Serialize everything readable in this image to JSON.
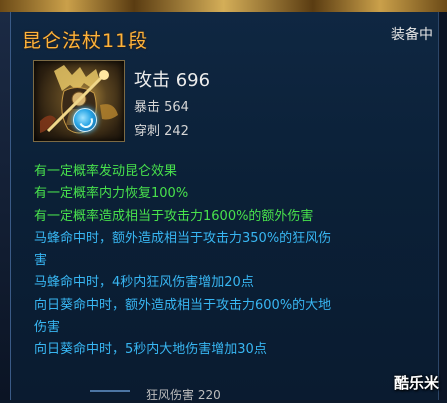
{
  "item": {
    "title": "昆仑法杖11段",
    "status": "装备中",
    "main_stat": "攻击 696",
    "sub_stats": [
      "暴击 564",
      "穿刺 242"
    ]
  },
  "effects": [
    {
      "text": "有一定概率发动昆仑效果",
      "color": "#48e14c"
    },
    {
      "text": "有一定概率内力恢复100%",
      "color": "#48e14c"
    },
    {
      "text": "有一定概率造成相当于攻击力1600%的额外伤害",
      "color": "#48e14c"
    },
    {
      "text": "马蜂命中时，额外造成相当于攻击力350%的狂风伤",
      "color": "#38b6f2"
    },
    {
      "text": "害",
      "color": "#38b6f2"
    },
    {
      "text": "马蜂命中时，4秒内狂风伤害增加20点",
      "color": "#38b6f2"
    },
    {
      "text": "向日葵命中时，额外造成相当于攻击力600%的大地",
      "color": "#38b6f2"
    },
    {
      "text": "伤害",
      "color": "#38b6f2"
    },
    {
      "text": "向日葵命中时，5秒内大地伤害增加30点",
      "color": "#38b6f2"
    }
  ],
  "bottom_text": "狂风伤害 220",
  "watermark": "酷乐米",
  "colors": {
    "title": "#ffb33a",
    "green_effect": "#48e14c",
    "blue_effect": "#38b6f2",
    "panel_bg": "#0f2742"
  },
  "icons": {
    "item_icon": "staff-warrior-icon",
    "badge_icon": "swirl-badge-icon"
  }
}
